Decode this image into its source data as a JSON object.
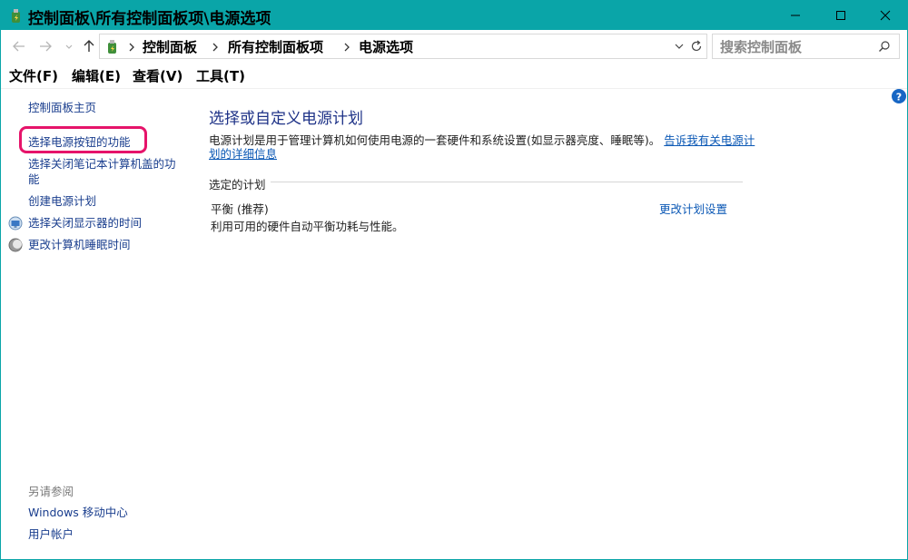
{
  "window": {
    "title": "控制面板\\所有控制面板项\\电源选项",
    "icon": "power-options-icon",
    "controls": {
      "minimize": "minimize-icon",
      "maximize": "maximize-icon",
      "close": "close-icon"
    }
  },
  "address_bar": {
    "crumbs": [
      "控制面板",
      "所有控制面板项",
      "电源选项"
    ],
    "search_placeholder": "搜索控制面板"
  },
  "menu": {
    "items": [
      "文件(F)",
      "编辑(E)",
      "查看(V)",
      "工具(T)"
    ]
  },
  "sidebar": {
    "home": "控制面板主页",
    "links": [
      {
        "label": "选择电源按钮的功能",
        "highlighted": true
      },
      {
        "label_line1": "选择关闭笔记本计算机盖的功",
        "label_line2": "能"
      },
      {
        "label": "创建电源计划"
      },
      {
        "label": "选择关闭显示器的时间",
        "icon": "monitor-icon"
      },
      {
        "label": "更改计算机睡眠时间",
        "icon": "moon-icon"
      }
    ],
    "see_also": {
      "heading": "另请参阅",
      "links": [
        "Windows 移动中心",
        "用户帐户"
      ]
    }
  },
  "main": {
    "title": "选择或自定义电源计划",
    "description": "电源计划是用于管理计算机如何使用电源的一套硬件和系统设置(如显示器亮度、睡眠等)。",
    "description_link_part1": "告诉我有关电源计",
    "description_link_part2": "划的详细信息",
    "section_label": "选定的计划",
    "plan": {
      "name": "平衡 (推荐)",
      "description": "利用可用的硬件自动平衡功耗与性能。",
      "settings_link": "更改计划设置"
    }
  },
  "colors": {
    "titlebar": "#0aa5a8",
    "link": "#1a3e8e",
    "highlight_border": "#e6136a",
    "heading": "#1e3287"
  }
}
